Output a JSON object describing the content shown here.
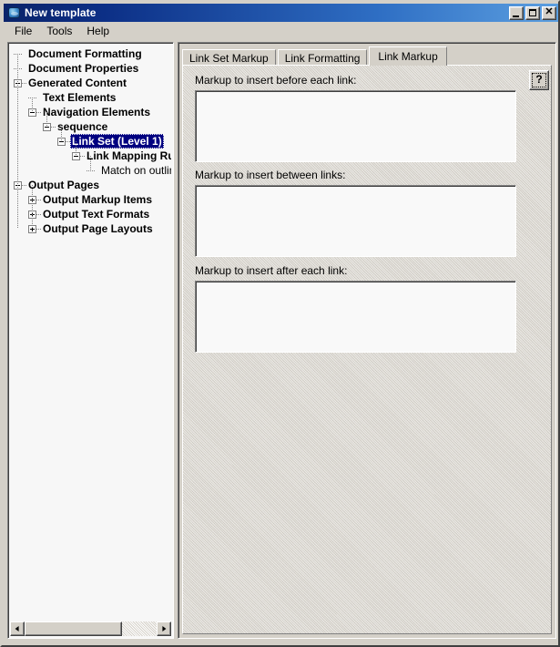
{
  "window": {
    "title": "New template",
    "icon": "app-globe-icon",
    "controls": {
      "minimize": "minimize-icon",
      "maximize": "maximize-icon",
      "close": "close-icon"
    }
  },
  "menu": {
    "items": [
      {
        "label": "File"
      },
      {
        "label": "Tools"
      },
      {
        "label": "Help"
      }
    ]
  },
  "tree": {
    "items": [
      {
        "label": "Document Formatting",
        "depth": 0,
        "expander": "none",
        "bold": true,
        "selected": false
      },
      {
        "label": "Document Properties",
        "depth": 0,
        "expander": "none",
        "bold": true,
        "selected": false
      },
      {
        "label": "Generated Content",
        "depth": 0,
        "expander": "collapse",
        "bold": true,
        "selected": false
      },
      {
        "label": "Text Elements",
        "depth": 1,
        "expander": "none",
        "bold": true,
        "selected": false
      },
      {
        "label": "Navigation Elements",
        "depth": 1,
        "expander": "collapse",
        "bold": true,
        "selected": false
      },
      {
        "label": "sequence",
        "depth": 2,
        "expander": "collapse",
        "bold": true,
        "selected": false
      },
      {
        "label": "Link Set (Level 1)",
        "depth": 3,
        "expander": "collapse",
        "bold": true,
        "selected": true
      },
      {
        "label": "Link Mapping Ru",
        "depth": 4,
        "expander": "collapse",
        "bold": true,
        "selected": false
      },
      {
        "label": "Match on outlin",
        "depth": 5,
        "expander": "none",
        "bold": false,
        "selected": false
      },
      {
        "label": "Output Pages",
        "depth": 0,
        "expander": "collapse",
        "bold": true,
        "selected": false
      },
      {
        "label": "Output Markup Items",
        "depth": 1,
        "expander": "expand",
        "bold": true,
        "selected": false
      },
      {
        "label": "Output Text Formats",
        "depth": 1,
        "expander": "expand",
        "bold": true,
        "selected": false
      },
      {
        "label": "Output Page Layouts",
        "depth": 1,
        "expander": "expand",
        "bold": true,
        "selected": false
      }
    ],
    "selection_color": "#000080",
    "scrollbar": {
      "left_arrow": "scroll-left-icon",
      "right_arrow": "scroll-right-icon",
      "thumb_fraction": 0.74
    }
  },
  "tabs": [
    {
      "label": "Link Set Markup",
      "active": false
    },
    {
      "label": "Link Formatting",
      "active": false
    },
    {
      "label": "Link Markup",
      "active": true
    }
  ],
  "panel": {
    "fields": [
      {
        "label": "Markup to insert before each link:",
        "value": "",
        "placeholder": ""
      },
      {
        "label": "Markup to insert between links:",
        "value": "",
        "placeholder": ""
      },
      {
        "label": "Markup to insert after each link:",
        "value": "",
        "placeholder": ""
      }
    ],
    "help_button": {
      "glyph": "?",
      "icon": "help-question-icon"
    }
  }
}
